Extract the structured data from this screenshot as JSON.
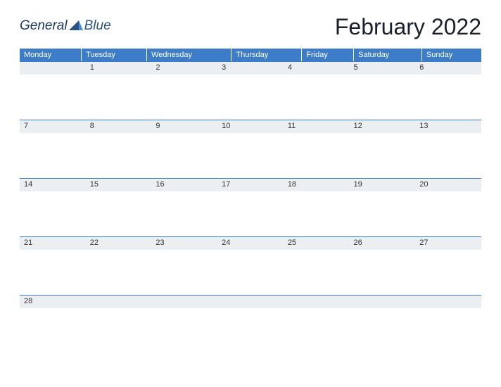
{
  "logo": {
    "word1": "General",
    "word2": "Blue"
  },
  "title": "February 2022",
  "days": [
    "Monday",
    "Tuesday",
    "Wednesday",
    "Thursday",
    "Friday",
    "Saturday",
    "Sunday"
  ],
  "weeks": [
    [
      "",
      "1",
      "2",
      "3",
      "4",
      "5",
      "6"
    ],
    [
      "7",
      "8",
      "9",
      "10",
      "11",
      "12",
      "13"
    ],
    [
      "14",
      "15",
      "16",
      "17",
      "18",
      "19",
      "20"
    ],
    [
      "21",
      "22",
      "23",
      "24",
      "25",
      "26",
      "27"
    ],
    [
      "28",
      "",
      "",
      "",
      "",
      "",
      ""
    ]
  ]
}
